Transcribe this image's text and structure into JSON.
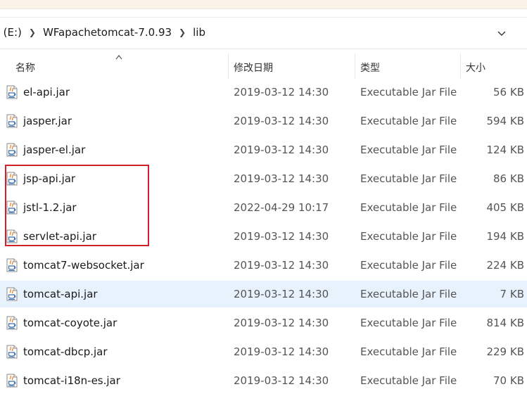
{
  "breadcrumb": {
    "drive": "t (E:)",
    "folder": "WFapachetomcat-7.0.93",
    "subfolder": "lib"
  },
  "columns": {
    "name": "名称",
    "date": "修改日期",
    "type": "类型",
    "size": "大小"
  },
  "files": [
    {
      "name": "el-api.jar",
      "date": "2019-03-12 14:30",
      "type": "Executable Jar File",
      "size": "56 KB"
    },
    {
      "name": "jasper.jar",
      "date": "2019-03-12 14:30",
      "type": "Executable Jar File",
      "size": "594 KB"
    },
    {
      "name": "jasper-el.jar",
      "date": "2019-03-12 14:30",
      "type": "Executable Jar File",
      "size": "124 KB"
    },
    {
      "name": "jsp-api.jar",
      "date": "2019-03-12 14:30",
      "type": "Executable Jar File",
      "size": "86 KB"
    },
    {
      "name": "jstl-1.2.jar",
      "date": "2022-04-29 10:17",
      "type": "Executable Jar File",
      "size": "405 KB"
    },
    {
      "name": "servlet-api.jar",
      "date": "2019-03-12 14:30",
      "type": "Executable Jar File",
      "size": "194 KB"
    },
    {
      "name": "tomcat7-websocket.jar",
      "date": "2019-03-12 14:30",
      "type": "Executable Jar File",
      "size": "224 KB"
    },
    {
      "name": "tomcat-api.jar",
      "date": "2019-03-12 14:30",
      "type": "Executable Jar File",
      "size": "7 KB"
    },
    {
      "name": "tomcat-coyote.jar",
      "date": "2019-03-12 14:30",
      "type": "Executable Jar File",
      "size": "814 KB"
    },
    {
      "name": "tomcat-dbcp.jar",
      "date": "2019-03-12 14:30",
      "type": "Executable Jar File",
      "size": "229 KB"
    },
    {
      "name": "tomcat-i18n-es.jar",
      "date": "2019-03-12 14:30",
      "type": "Executable Jar File",
      "size": "70 KB"
    }
  ],
  "selected_file": "tomcat-api.jar",
  "annotation": {
    "highlight_color": "#d0202a",
    "highlighted_files": [
      "jsp-api.jar",
      "jstl-1.2.jar",
      "servlet-api.jar"
    ]
  },
  "colors": {
    "selected_row": "#e8f2fc",
    "top_strip": "#fbf3ea"
  },
  "icons": {
    "file": "java-jar-icon",
    "separator": "chevron-right-icon",
    "address_dropdown": "chevron-down-icon",
    "sort": "sort-ascending-icon"
  }
}
